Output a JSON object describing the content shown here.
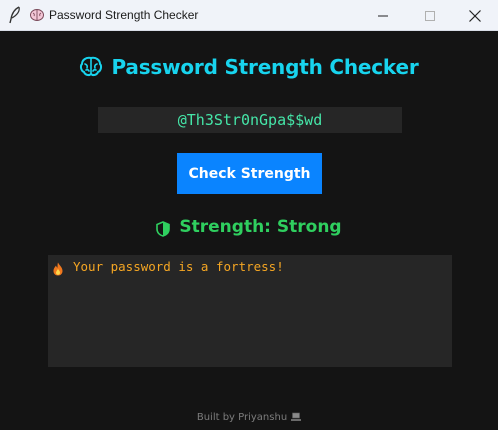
{
  "window": {
    "title": "Password Strength Checker"
  },
  "header": {
    "title": "Password Strength Checker",
    "icon": "brain-icon",
    "color": "#18d4ee"
  },
  "password_input": {
    "value": "@Th3Str0nGpa$$wd"
  },
  "check_button": {
    "label": "Check Strength",
    "color": "#0a84ff"
  },
  "strength": {
    "label": "Strength: Strong",
    "icon": "half-shield-icon",
    "color": "#2fcf5f"
  },
  "feedback": {
    "icon": "fire-icon",
    "message": "Your password is a fortress!",
    "color": "#f5a623"
  },
  "footer": {
    "text": "Built by Priyanshu",
    "icon": "laptop-icon"
  }
}
